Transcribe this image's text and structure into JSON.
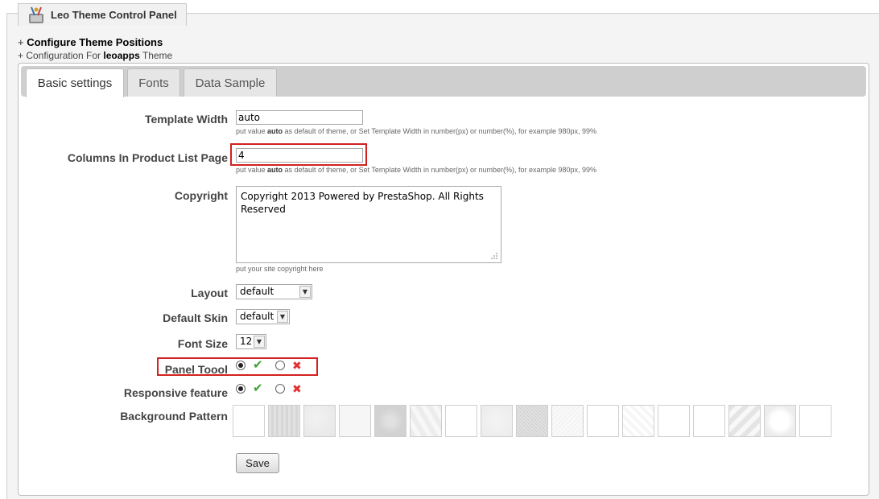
{
  "panel": {
    "title": "Leo Theme Control Panel"
  },
  "breadcrumbs": {
    "line1_prefix": "+ ",
    "line1_bold": "Configure Theme Positions",
    "line2_prefix": "+ Configuration For ",
    "line2_bold": "leoapps",
    "line2_suffix": " Theme"
  },
  "tabs": [
    {
      "label": "Basic settings",
      "active": true
    },
    {
      "label": "Fonts",
      "active": false
    },
    {
      "label": "Data Sample",
      "active": false
    }
  ],
  "form": {
    "template_width": {
      "label": "Template Width",
      "value": "auto",
      "hint_prefix": "put value ",
      "hint_bold": "auto",
      "hint_suffix": " as default of theme, or Set Template Width in number(px) or number(%), for example 980px, 99%"
    },
    "columns": {
      "label": "Columns In Product List Page",
      "value": "4",
      "hint_prefix": "put value ",
      "hint_bold": "auto",
      "hint_suffix": " as default of theme, or Set Template Width in number(px) or number(%), for example 980px, 99%"
    },
    "copyright": {
      "label": "Copyright",
      "value": "Copyright 2013 Powered by PrestaShop. All Rights Reserved",
      "hint": "put your site copyright here"
    },
    "layout": {
      "label": "Layout",
      "value": "default"
    },
    "default_skin": {
      "label": "Default Skin",
      "value": "default"
    },
    "font_size": {
      "label": "Font Size",
      "value": "12"
    },
    "panel_tool": {
      "label": "Panel Toool",
      "selected": "yes"
    },
    "responsive": {
      "label": "Responsive feature",
      "selected": "yes"
    },
    "background_pattern": {
      "label": "Background Pattern",
      "count": 17
    },
    "save_label": "Save"
  },
  "colors": {
    "highlight": "#d32020",
    "check": "#3ca335",
    "cross": "#e23030"
  },
  "icons": {
    "logo": "theme-tools-icon",
    "yes": "check-icon",
    "no": "cross-icon"
  }
}
